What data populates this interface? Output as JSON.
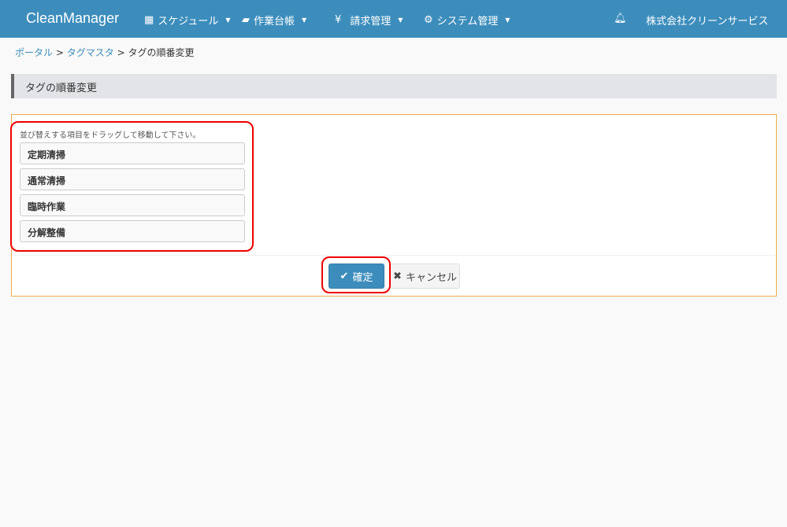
{
  "nav": {
    "brand": "CleanManager",
    "menus": [
      {
        "icon": "calendar-icon",
        "label": "スケジュール"
      },
      {
        "icon": "book-icon",
        "label": "作業台帳"
      },
      {
        "icon": "yen-icon",
        "label": "請求管理"
      },
      {
        "icon": "gears-icon",
        "label": "システム管理"
      }
    ],
    "company": "株式会社クリーンサービス"
  },
  "breadcrumb": {
    "portal": "ポータル",
    "tagmaster": "タグマスタ",
    "current": "タグの順番変更",
    "sep": ">"
  },
  "heading": "タグの順番変更",
  "panel": {
    "hint": "並び替えする項目をドラッグして移動して下さい。",
    "items": [
      "定期清掃",
      "通常清掃",
      "臨時作業",
      "分解整備"
    ],
    "confirm": "確定",
    "cancel": "キャンセル"
  }
}
